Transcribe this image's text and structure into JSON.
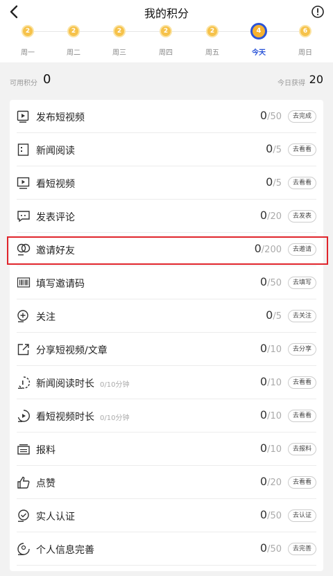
{
  "header": {
    "title": "我的积分"
  },
  "week": [
    {
      "label": "周一",
      "coin": "2",
      "today": false
    },
    {
      "label": "周二",
      "coin": "2",
      "today": false
    },
    {
      "label": "周三",
      "coin": "2",
      "today": false
    },
    {
      "label": "周四",
      "coin": "2",
      "today": false
    },
    {
      "label": "周五",
      "coin": "2",
      "today": false
    },
    {
      "label": "今天",
      "coin": "4",
      "today": true
    },
    {
      "label": "周日",
      "coin": "6",
      "today": false
    }
  ],
  "summary": {
    "available_label": "可用积分",
    "available_value": "0",
    "today_label": "今日获得",
    "today_value": "20"
  },
  "tasks": [
    {
      "icon": "video-upload-icon",
      "name": "发布短视频",
      "sub": "",
      "current": "0",
      "max": "/50",
      "action": "去完成"
    },
    {
      "icon": "news-icon",
      "name": "新闻阅读",
      "sub": "",
      "current": "0",
      "max": "/5",
      "action": "去看看"
    },
    {
      "icon": "play-screen-icon",
      "name": "看短视频",
      "sub": "",
      "current": "0",
      "max": "/5",
      "action": "去看看"
    },
    {
      "icon": "comment-icon",
      "name": "发表评论",
      "sub": "",
      "current": "0",
      "max": "/20",
      "action": "去发表"
    },
    {
      "icon": "invite-friends-icon",
      "name": "邀请好友",
      "sub": "",
      "current": "0",
      "max": "/200",
      "action": "去邀请"
    },
    {
      "icon": "barcode-icon",
      "name": "填写邀请码",
      "sub": "",
      "current": "0",
      "max": "/50",
      "action": "去填写"
    },
    {
      "icon": "follow-icon",
      "name": "关注",
      "sub": "",
      "current": "0",
      "max": "/5",
      "action": "去关注"
    },
    {
      "icon": "share-icon",
      "name": "分享短视频/文章",
      "sub": "",
      "current": "0",
      "max": "/10",
      "action": "去分享"
    },
    {
      "icon": "reading-timer-icon",
      "name": "新闻阅读时长",
      "sub": "0/10分钟",
      "current": "0",
      "max": "/10",
      "action": "去看看"
    },
    {
      "icon": "video-timer-icon",
      "name": "看短视频时长",
      "sub": "0/10分钟",
      "current": "0",
      "max": "/10",
      "action": "去看看"
    },
    {
      "icon": "report-icon",
      "name": "报料",
      "sub": "",
      "current": "0",
      "max": "/10",
      "action": "去报料"
    },
    {
      "icon": "thumbs-up-icon",
      "name": "点赞",
      "sub": "",
      "current": "0",
      "max": "/20",
      "action": "去看看"
    },
    {
      "icon": "verify-icon",
      "name": "实人认证",
      "sub": "",
      "current": "0",
      "max": "/50",
      "action": "去认证"
    },
    {
      "icon": "profile-icon",
      "name": "个人信息完善",
      "sub": "",
      "current": "0",
      "max": "/50",
      "action": "去完善"
    }
  ],
  "colors": {
    "accent": "#2a54d8",
    "coin": "#f6c24a",
    "highlight": "#e0242b"
  }
}
